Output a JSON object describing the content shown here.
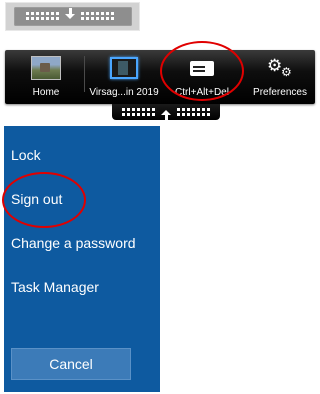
{
  "toolbar": {
    "buttons": [
      {
        "label": "Home",
        "icon": "home-thumbnail-icon"
      },
      {
        "label": "Virsag...in 2019",
        "icon": "vm-thumbnail-icon"
      },
      {
        "label": "Ctrl+Alt+Del",
        "icon": "keyboard-icon"
      },
      {
        "label": "Preferences",
        "icon": "gears-icon"
      }
    ]
  },
  "security_menu": {
    "items": [
      "Lock",
      "Sign out",
      "Change a password",
      "Task Manager"
    ],
    "cancel_label": "Cancel"
  },
  "colors": {
    "menu_background": "#0e5aa0",
    "cancel_background": "#3c7bb8",
    "annotation": "#e00000",
    "toolbar": "#000000"
  }
}
